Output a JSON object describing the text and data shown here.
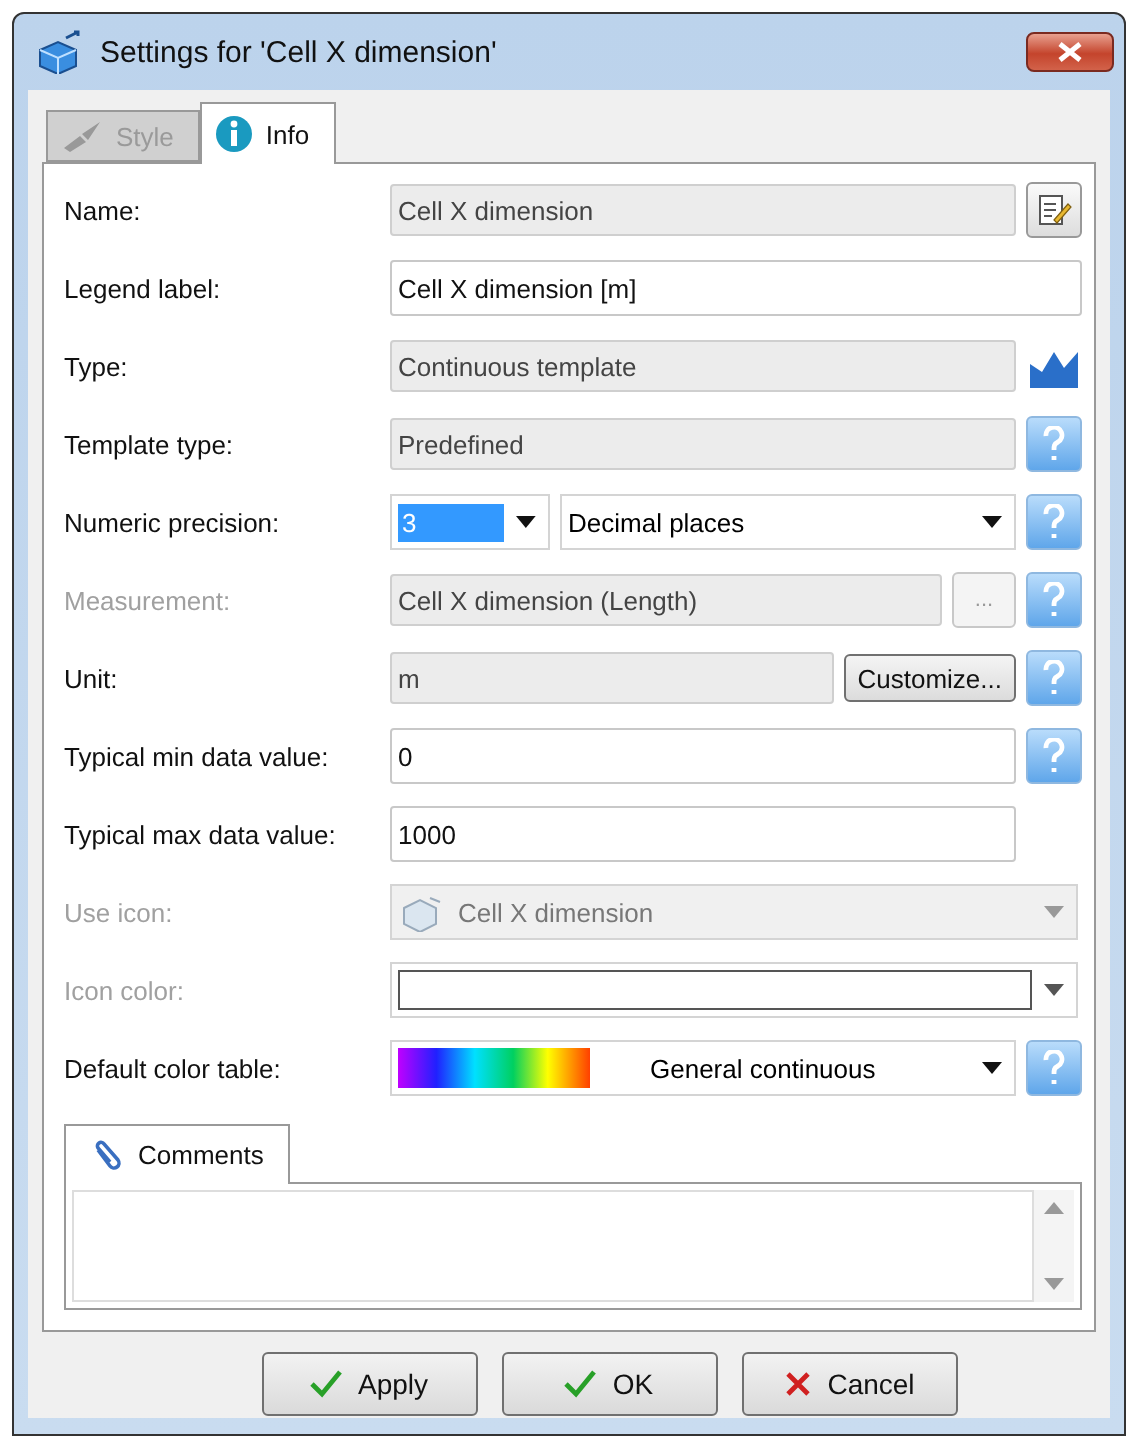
{
  "window": {
    "title": "Settings for 'Cell X dimension'"
  },
  "tabs": [
    {
      "label": "Style",
      "selected": false,
      "disabled": true
    },
    {
      "label": "Info",
      "selected": true,
      "disabled": false
    }
  ],
  "rows": [
    {
      "label": "Name:",
      "disabled": false,
      "field": {
        "kind": "readonly",
        "value": "Cell X dimension"
      },
      "extras": [
        {
          "kind": "edit"
        }
      ]
    },
    {
      "label": "Legend label:",
      "disabled": false,
      "field": {
        "kind": "text",
        "value": "Cell X dimension [m]"
      },
      "extras": []
    },
    {
      "label": "Type:",
      "disabled": false,
      "field": {
        "kind": "readonly",
        "value": "Continuous template"
      },
      "extras": [
        {
          "kind": "chart"
        }
      ]
    },
    {
      "label": "Template type:",
      "disabled": false,
      "field": {
        "kind": "readonly",
        "value": "Predefined"
      },
      "extras": [
        {
          "kind": "help"
        }
      ]
    },
    {
      "label": "Numeric precision:",
      "disabled": false,
      "field": {
        "kind": "precision",
        "value": "3",
        "highlighted": true,
        "unit": "Decimal places"
      },
      "extras": [
        {
          "kind": "help"
        }
      ]
    },
    {
      "label": "Measurement:",
      "disabled": true,
      "field": {
        "kind": "readonly",
        "value": "Cell X dimension (Length)"
      },
      "extras": [
        {
          "kind": "button",
          "label": "..."
        },
        {
          "kind": "help"
        }
      ]
    },
    {
      "label": "Unit:",
      "disabled": false,
      "field": {
        "kind": "readonly",
        "value": "m"
      },
      "extras": [
        {
          "kind": "button",
          "label": "Customize..."
        },
        {
          "kind": "help"
        }
      ]
    },
    {
      "label": "Typical min data value:",
      "disabled": false,
      "field": {
        "kind": "text",
        "value": "0"
      },
      "extras": [
        {
          "kind": "help"
        }
      ]
    },
    {
      "label": "Typical max data value:",
      "disabled": false,
      "field": {
        "kind": "text",
        "value": "1000"
      },
      "extras": [
        {
          "kind": "blank"
        }
      ]
    },
    {
      "label": "Use icon:",
      "disabled": true,
      "field": {
        "kind": "iconcombo",
        "value": "Cell X dimension"
      },
      "extras": []
    },
    {
      "label": "Icon color:",
      "disabled": true,
      "field": {
        "kind": "color"
      },
      "extras": []
    },
    {
      "label": "Default color table:",
      "disabled": false,
      "field": {
        "kind": "colortable",
        "value": "General continuous"
      },
      "extras": [
        {
          "kind": "help"
        }
      ]
    }
  ],
  "comments": {
    "tab": "Comments"
  },
  "buttons": [
    {
      "label": "Apply",
      "kind": "ok"
    },
    {
      "label": "OK",
      "kind": "ok"
    },
    {
      "label": "Cancel",
      "kind": "cancel"
    }
  ]
}
